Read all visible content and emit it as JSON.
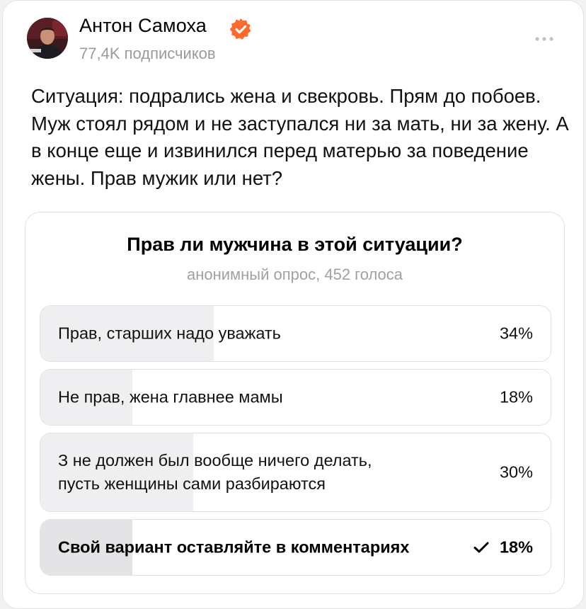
{
  "author": {
    "name": "Антон Самоха",
    "subscribers": "77,4K подписчиков",
    "avatar_icon": "avatar-photo",
    "verified_icon": "verified-badge-icon",
    "verified_color": "#ff6a2b"
  },
  "post": {
    "text": "Ситуация: подрались жена и свекровь. Прям до побоев. Муж стоял рядом и не заступался ни за мать, ни за жену. А в конце еще и извинился перед матерью за поведение жены. Прав мужик или нет?"
  },
  "poll": {
    "title": "Прав ли мужчина в этой ситуации?",
    "meta": "анонимный опрос, 452 голоса",
    "options": [
      {
        "label": "Прав, старших надо уважать",
        "percent": "34%",
        "value": 34,
        "selected": false
      },
      {
        "label": "Не прав, жена главнее мамы",
        "percent": "18%",
        "value": 18,
        "selected": false
      },
      {
        "label": "З не должен был вообще ничего делать,\nпусть женщины сами разбираются",
        "percent": "30%",
        "value": 30,
        "selected": false
      },
      {
        "label": "Свой вариант оставляйте в комментариях",
        "percent": "18%",
        "value": 18,
        "selected": true
      }
    ]
  },
  "colors": {
    "bar_fill": "#efeff1",
    "muted_text": "#9a9a9f"
  }
}
